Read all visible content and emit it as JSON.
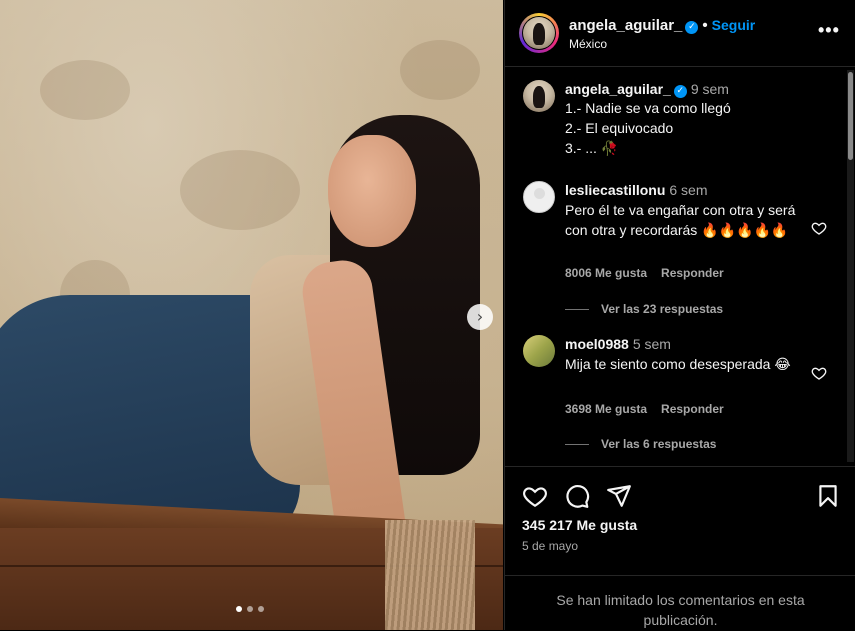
{
  "post": {
    "username": "angela_aguilar_",
    "verified_mark": "✓",
    "dot": "•",
    "follow_label": "Seguir",
    "location": "México",
    "more_label": "•••",
    "likes": "345 217 Me gusta",
    "date": "5 de mayo",
    "limited_notice": "Se han limitado los comentarios en esta publicación.",
    "carousel_next": "›"
  },
  "caption": {
    "username": "angela_aguilar_",
    "time": "9 sem",
    "lines": [
      "1.- Nadie se va como llegó",
      "2.- El equivocado",
      "3.- ... 🥀"
    ]
  },
  "comments": [
    {
      "username": "lesliecastillonu",
      "time": "6 sem",
      "text": "Pero él te va engañar con otra y será con otra y recordarás 🔥🔥🔥🔥🔥",
      "likes": "8006 Me gusta",
      "reply_label": "Responder",
      "view_replies": "Ver las 23 respuestas"
    },
    {
      "username": "moel0988",
      "time": "5 sem",
      "text": "Mija te siento como desesperada 😂",
      "likes": "3698 Me gusta",
      "reply_label": "Responder",
      "view_replies": "Ver las 6 respuestas"
    }
  ],
  "icons": [
    "heart-icon",
    "comment-icon",
    "share-icon",
    "bookmark-icon",
    "verified-icon",
    "more-icon",
    "chevron-right-icon"
  ],
  "colors": {
    "background": "#000000",
    "link_blue": "#0095f6",
    "muted": "#a8a8a8",
    "divider": "#262626"
  }
}
